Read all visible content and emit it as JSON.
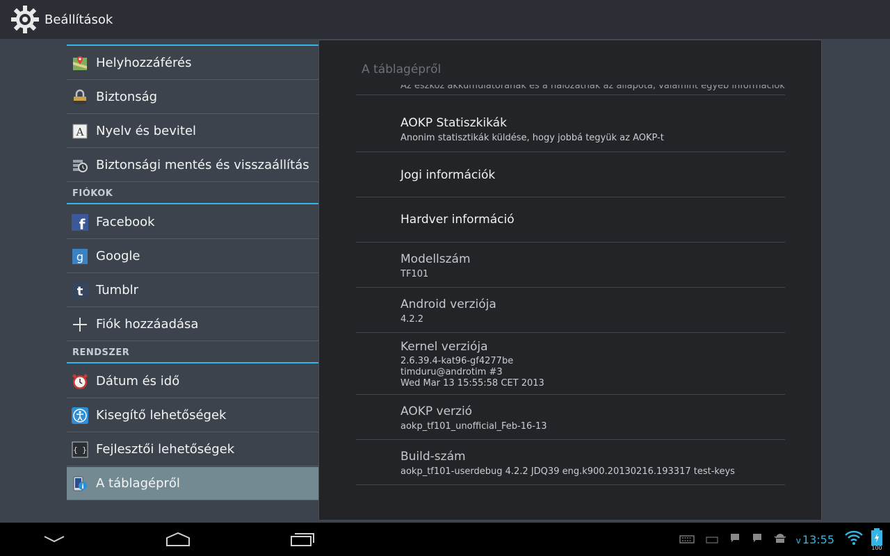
{
  "app": {
    "title": "Beállítások",
    "icon": "settings-gear-icon"
  },
  "sidebar": {
    "items_top": [
      {
        "label": "Helyhozzáférés",
        "icon": "location-map-icon"
      },
      {
        "label": "Biztonság",
        "icon": "lock-icon"
      },
      {
        "label": "Nyelv és bevitel",
        "icon": "language-a-icon"
      },
      {
        "label": "Biztonsági mentés és visszaállítás",
        "icon": "backup-restore-icon"
      }
    ],
    "accounts_header": "FIÓKOK",
    "accounts": [
      {
        "label": "Facebook",
        "icon": "facebook-icon"
      },
      {
        "label": "Google",
        "icon": "google-icon"
      },
      {
        "label": "Tumblr",
        "icon": "tumblr-icon"
      },
      {
        "label": "Fiók hozzáadása",
        "icon": "plus-icon"
      }
    ],
    "system_header": "RENDSZER",
    "system": [
      {
        "label": "Dátum és idő",
        "icon": "alarm-clock-icon"
      },
      {
        "label": "Kisegítő lehetőségek",
        "icon": "accessibility-icon"
      },
      {
        "label": "Fejlesztői lehetőségek",
        "icon": "developer-braces-icon"
      },
      {
        "label": "A táblagépről",
        "icon": "tablet-info-icon",
        "selected": true
      }
    ]
  },
  "detail": {
    "title": "A táblagépről",
    "cutoff_summary": "Az eszköz akkumulátorának és a hálózatnak az állapota, valamint egyéb információk",
    "items": [
      {
        "title": "AOKP Statiszkikák",
        "summary": "Anonim statisztikák küldése, hogy jobbá tegyük az AOKP-t"
      },
      {
        "title": "Jogi információk"
      },
      {
        "title": "Hardver információ"
      },
      {
        "title": "Modellszám",
        "summary": "TF101"
      },
      {
        "title": "Android verziója",
        "summary": "4.2.2"
      },
      {
        "title": "Kernel verziója",
        "summary_lines": [
          "2.6.39.4-kat96-gf4277be",
          "timduru@androtim #3",
          "Wed Mar 13 15:55:58 CET 2013"
        ]
      },
      {
        "title": "AOKP verzió",
        "summary": "aokp_tf101_unofficial_Feb-16-13"
      },
      {
        "title": "Build-szám",
        "summary": "aokp_tf101-userdebug 4.2.2 JDQ39 eng.k900.20130216.193317 test-keys"
      }
    ]
  },
  "navbar": {
    "buttons": [
      "back-icon",
      "home-icon",
      "recent-apps-icon"
    ],
    "status": {
      "clock_prefix": "v",
      "time": "13:55",
      "battery": "100",
      "icons": [
        "keyboard-icon",
        "keyboard-small-icon",
        "chat-icon",
        "chat-icon-2",
        "android-debug-icon",
        "wifi-icon",
        "battery-icon"
      ]
    }
  },
  "colors": {
    "accent": "#33b5e5",
    "selected": "#738a93",
    "panel": "#232428",
    "background": "#3d434d"
  }
}
